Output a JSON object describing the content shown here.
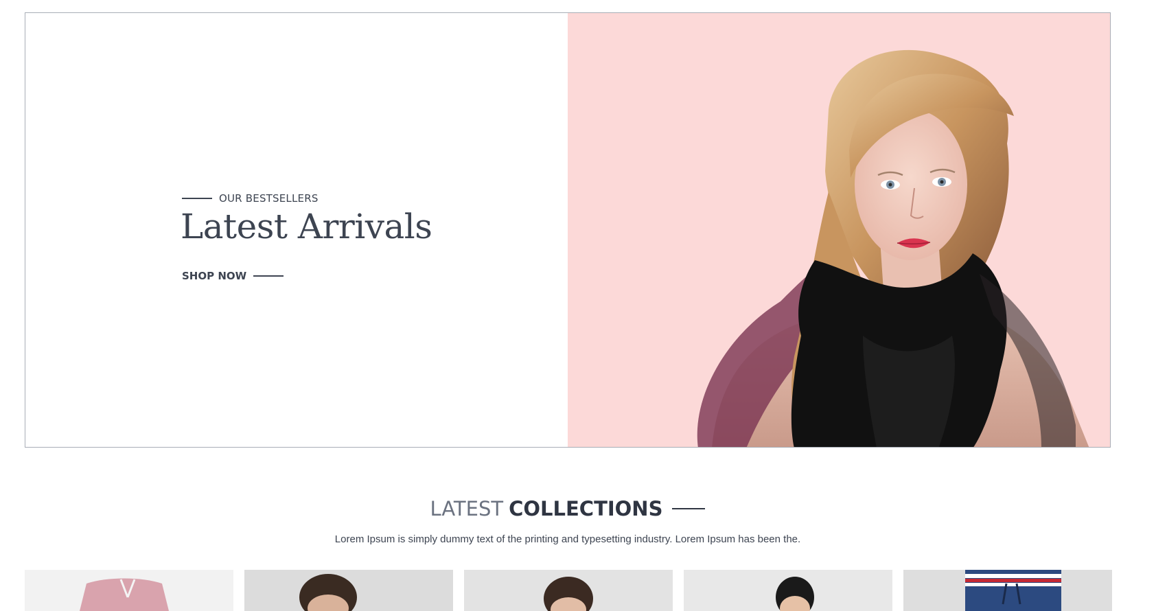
{
  "hero": {
    "eyebrow": "OUR BESTSELLERS",
    "title": "Latest Arrivals",
    "cta": "SHOP NOW",
    "image_alt": "model-with-black-scarf",
    "bg_color": "#fcd9d8"
  },
  "collections": {
    "title_light": "LATEST",
    "title_bold": "COLLECTIONS",
    "description": "Lorem Ipsum is simply dummy text of the printing and typesetting industry. Lorem Ipsum has been the.",
    "items": [
      {
        "image": "pink-shorts"
      },
      {
        "image": "man-curly-hair"
      },
      {
        "image": "boy-portrait"
      },
      {
        "image": "woman-portrait"
      },
      {
        "image": "navy-track-pants"
      }
    ]
  }
}
